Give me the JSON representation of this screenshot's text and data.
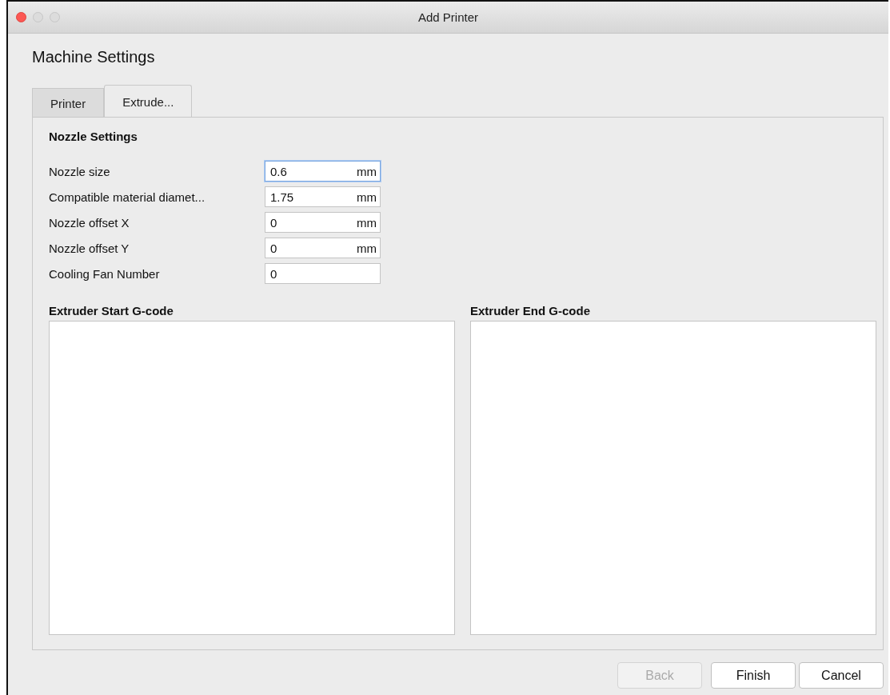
{
  "window": {
    "title": "Add Printer"
  },
  "heading": "Machine Settings",
  "tabs": [
    {
      "label": "Printer",
      "selected": false
    },
    {
      "label": "Extrude...",
      "selected": true
    }
  ],
  "nozzle_settings": {
    "title": "Nozzle Settings",
    "fields": [
      {
        "label": "Nozzle size",
        "value": "0.6",
        "unit": "mm",
        "focused": true
      },
      {
        "label": "Compatible material diamet...",
        "value": "1.75",
        "unit": "mm",
        "focused": false
      },
      {
        "label": "Nozzle offset X",
        "value": "0",
        "unit": "mm",
        "focused": false
      },
      {
        "label": "Nozzle offset Y",
        "value": "0",
        "unit": "mm",
        "focused": false
      },
      {
        "label": "Cooling Fan Number",
        "value": "0",
        "focused": false
      }
    ]
  },
  "gcode": [
    {
      "title": "Extruder Start G-code"
    },
    {
      "title": "Extruder End G-code"
    }
  ],
  "buttons": [
    {
      "label": "Back",
      "disabled": true
    },
    {
      "label": "Finish",
      "disabled": false
    },
    {
      "label": "Cancel",
      "disabled": false
    }
  ]
}
